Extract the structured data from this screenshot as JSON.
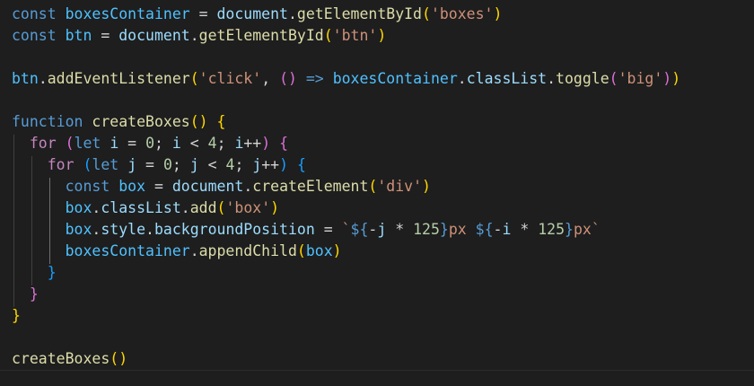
{
  "editor": {
    "language": "javascript",
    "theme_background": "#1e1e1e",
    "lines": [
      {
        "tokens": [
          {
            "t": "const",
            "c": "kw"
          },
          {
            "t": " ",
            "c": "op"
          },
          {
            "t": "boxesContainer",
            "c": "const"
          },
          {
            "t": " = ",
            "c": "op"
          },
          {
            "t": "document",
            "c": "var"
          },
          {
            "t": ".",
            "c": "op"
          },
          {
            "t": "getElementById",
            "c": "fn"
          },
          {
            "t": "(",
            "c": "b1"
          },
          {
            "t": "'boxes'",
            "c": "str"
          },
          {
            "t": ")",
            "c": "b1"
          }
        ]
      },
      {
        "tokens": [
          {
            "t": "const",
            "c": "kw"
          },
          {
            "t": " ",
            "c": "op"
          },
          {
            "t": "btn",
            "c": "const"
          },
          {
            "t": " = ",
            "c": "op"
          },
          {
            "t": "document",
            "c": "var"
          },
          {
            "t": ".",
            "c": "op"
          },
          {
            "t": "getElementById",
            "c": "fn"
          },
          {
            "t": "(",
            "c": "b1"
          },
          {
            "t": "'btn'",
            "c": "str"
          },
          {
            "t": ")",
            "c": "b1"
          }
        ]
      },
      {
        "tokens": []
      },
      {
        "tokens": [
          {
            "t": "btn",
            "c": "const"
          },
          {
            "t": ".",
            "c": "op"
          },
          {
            "t": "addEventListener",
            "c": "fn"
          },
          {
            "t": "(",
            "c": "b1"
          },
          {
            "t": "'click'",
            "c": "str"
          },
          {
            "t": ", ",
            "c": "op"
          },
          {
            "t": "()",
            "c": "b2"
          },
          {
            "t": " ",
            "c": "op"
          },
          {
            "t": "=>",
            "c": "kw"
          },
          {
            "t": " ",
            "c": "op"
          },
          {
            "t": "boxesContainer",
            "c": "const"
          },
          {
            "t": ".",
            "c": "op"
          },
          {
            "t": "classList",
            "c": "var"
          },
          {
            "t": ".",
            "c": "op"
          },
          {
            "t": "toggle",
            "c": "fn"
          },
          {
            "t": "(",
            "c": "b2"
          },
          {
            "t": "'big'",
            "c": "str"
          },
          {
            "t": ")",
            "c": "b2"
          },
          {
            "t": ")",
            "c": "b1"
          }
        ]
      },
      {
        "tokens": []
      },
      {
        "tokens": [
          {
            "t": "function",
            "c": "kw"
          },
          {
            "t": " ",
            "c": "op"
          },
          {
            "t": "createBoxes",
            "c": "fn"
          },
          {
            "t": "()",
            "c": "b1"
          },
          {
            "t": " ",
            "c": "op"
          },
          {
            "t": "{",
            "c": "b1"
          }
        ]
      },
      {
        "tokens": [
          {
            "t": "  ",
            "c": "op"
          },
          {
            "t": "for",
            "c": "ctl"
          },
          {
            "t": " ",
            "c": "op"
          },
          {
            "t": "(",
            "c": "b2"
          },
          {
            "t": "let",
            "c": "kw"
          },
          {
            "t": " ",
            "c": "op"
          },
          {
            "t": "i",
            "c": "var"
          },
          {
            "t": " = ",
            "c": "op"
          },
          {
            "t": "0",
            "c": "num"
          },
          {
            "t": "; ",
            "c": "op"
          },
          {
            "t": "i",
            "c": "var"
          },
          {
            "t": " < ",
            "c": "op"
          },
          {
            "t": "4",
            "c": "num"
          },
          {
            "t": "; ",
            "c": "op"
          },
          {
            "t": "i",
            "c": "var"
          },
          {
            "t": "++",
            "c": "op"
          },
          {
            "t": ")",
            "c": "b2"
          },
          {
            "t": " ",
            "c": "op"
          },
          {
            "t": "{",
            "c": "b2"
          }
        ]
      },
      {
        "tokens": [
          {
            "t": "    ",
            "c": "op"
          },
          {
            "t": "for",
            "c": "ctl"
          },
          {
            "t": " ",
            "c": "op"
          },
          {
            "t": "(",
            "c": "b3"
          },
          {
            "t": "let",
            "c": "kw"
          },
          {
            "t": " ",
            "c": "op"
          },
          {
            "t": "j",
            "c": "var"
          },
          {
            "t": " = ",
            "c": "op"
          },
          {
            "t": "0",
            "c": "num"
          },
          {
            "t": "; ",
            "c": "op"
          },
          {
            "t": "j",
            "c": "var"
          },
          {
            "t": " < ",
            "c": "op"
          },
          {
            "t": "4",
            "c": "num"
          },
          {
            "t": "; ",
            "c": "op"
          },
          {
            "t": "j",
            "c": "var"
          },
          {
            "t": "++",
            "c": "op"
          },
          {
            "t": ")",
            "c": "b3"
          },
          {
            "t": " ",
            "c": "op"
          },
          {
            "t": "{",
            "c": "b3"
          }
        ]
      },
      {
        "tokens": [
          {
            "t": "      ",
            "c": "op"
          },
          {
            "t": "const",
            "c": "kw"
          },
          {
            "t": " ",
            "c": "op"
          },
          {
            "t": "box",
            "c": "const"
          },
          {
            "t": " = ",
            "c": "op"
          },
          {
            "t": "document",
            "c": "var"
          },
          {
            "t": ".",
            "c": "op"
          },
          {
            "t": "createElement",
            "c": "fn"
          },
          {
            "t": "(",
            "c": "b1"
          },
          {
            "t": "'div'",
            "c": "str"
          },
          {
            "t": ")",
            "c": "b1"
          }
        ]
      },
      {
        "tokens": [
          {
            "t": "      ",
            "c": "op"
          },
          {
            "t": "box",
            "c": "const"
          },
          {
            "t": ".",
            "c": "op"
          },
          {
            "t": "classList",
            "c": "var"
          },
          {
            "t": ".",
            "c": "op"
          },
          {
            "t": "add",
            "c": "fn"
          },
          {
            "t": "(",
            "c": "b1"
          },
          {
            "t": "'box'",
            "c": "str"
          },
          {
            "t": ")",
            "c": "b1"
          }
        ]
      },
      {
        "tokens": [
          {
            "t": "      ",
            "c": "op"
          },
          {
            "t": "box",
            "c": "const"
          },
          {
            "t": ".",
            "c": "op"
          },
          {
            "t": "style",
            "c": "var"
          },
          {
            "t": ".",
            "c": "op"
          },
          {
            "t": "backgroundPosition",
            "c": "var"
          },
          {
            "t": " = ",
            "c": "op"
          },
          {
            "t": "`",
            "c": "str"
          },
          {
            "t": "${",
            "c": "tpl"
          },
          {
            "t": "-",
            "c": "op"
          },
          {
            "t": "j",
            "c": "var"
          },
          {
            "t": " * ",
            "c": "op"
          },
          {
            "t": "125",
            "c": "num"
          },
          {
            "t": "}",
            "c": "tpl"
          },
          {
            "t": "px ",
            "c": "str"
          },
          {
            "t": "${",
            "c": "tpl"
          },
          {
            "t": "-",
            "c": "op"
          },
          {
            "t": "i",
            "c": "var"
          },
          {
            "t": " * ",
            "c": "op"
          },
          {
            "t": "125",
            "c": "num"
          },
          {
            "t": "}",
            "c": "tpl"
          },
          {
            "t": "px`",
            "c": "str"
          }
        ]
      },
      {
        "tokens": [
          {
            "t": "      ",
            "c": "op"
          },
          {
            "t": "boxesContainer",
            "c": "const"
          },
          {
            "t": ".",
            "c": "op"
          },
          {
            "t": "appendChild",
            "c": "fn"
          },
          {
            "t": "(",
            "c": "b1"
          },
          {
            "t": "box",
            "c": "const"
          },
          {
            "t": ")",
            "c": "b1"
          }
        ]
      },
      {
        "tokens": [
          {
            "t": "    ",
            "c": "op"
          },
          {
            "t": "}",
            "c": "b3"
          }
        ]
      },
      {
        "tokens": [
          {
            "t": "  ",
            "c": "op"
          },
          {
            "t": "}",
            "c": "b2"
          }
        ]
      },
      {
        "tokens": [
          {
            "t": "}",
            "c": "b1"
          }
        ]
      },
      {
        "tokens": []
      },
      {
        "tokens": [
          {
            "t": "createBoxes",
            "c": "fn"
          },
          {
            "t": "()",
            "c": "b1"
          }
        ]
      }
    ]
  }
}
